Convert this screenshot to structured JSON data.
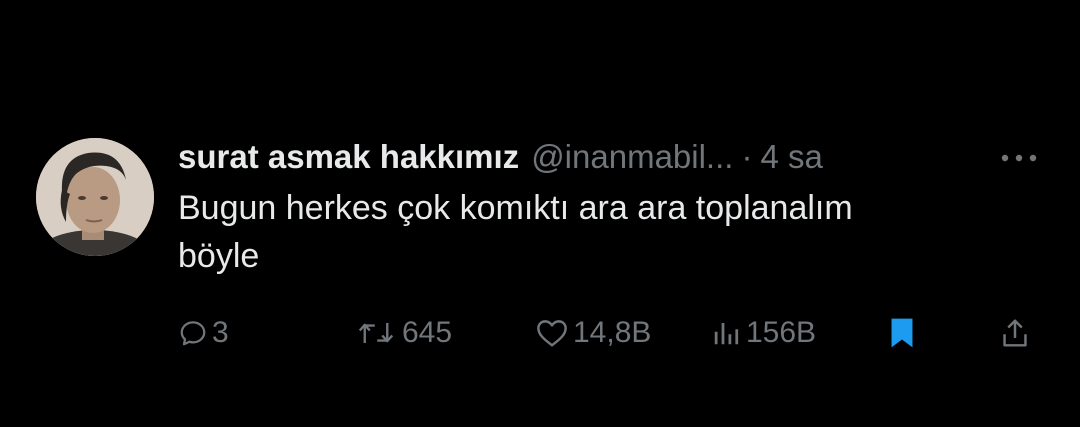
{
  "tweet": {
    "display_name": "surat asmak hakkımız",
    "handle": "@inanmabil...",
    "separator": "·",
    "time": "4 sa",
    "text": "Bugun herkes çok komıktı ara ara toplanalım\nböyle"
  },
  "actions": {
    "reply": {
      "icon": "reply-icon",
      "count": "3"
    },
    "retweet": {
      "icon": "retweet-icon",
      "count": "645"
    },
    "like": {
      "icon": "heart-icon",
      "count": "14,8B"
    },
    "views": {
      "icon": "views-icon",
      "count": "156B"
    },
    "bookmark": {
      "icon": "bookmark-icon",
      "active": true
    },
    "share": {
      "icon": "share-icon"
    }
  },
  "colors": {
    "background": "#000000",
    "primary_text": "#e7e9ea",
    "secondary_text": "#71767b",
    "bookmark_active": "#1d9bf0"
  }
}
